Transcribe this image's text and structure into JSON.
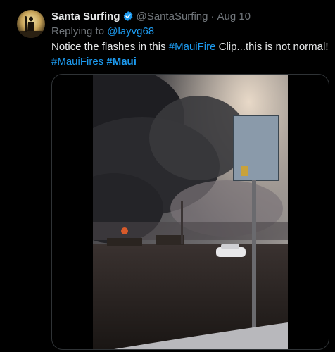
{
  "tweet": {
    "author_name": "Santa Surfing",
    "handle": "@SantaSurfing",
    "separator": "·",
    "date": "Aug 10",
    "reply_prefix": "Replying to",
    "reply_handle": "@layvg68",
    "text_part1": "Notice the flashes in this",
    "hashtag1": "#MauiFire",
    "text_part2": "Clip...this is not normal!",
    "hashtag2": "#MauiFires",
    "hashtag3": "#Maui"
  },
  "icons": {
    "verified": "verified-badge-icon",
    "avatar": "surfer-avatar"
  },
  "colors": {
    "background": "#000000",
    "text": "#e7e9ea",
    "muted": "#71767b",
    "link": "#1d9bf0",
    "verified": "#1d9bf0",
    "border": "#2f3336"
  }
}
